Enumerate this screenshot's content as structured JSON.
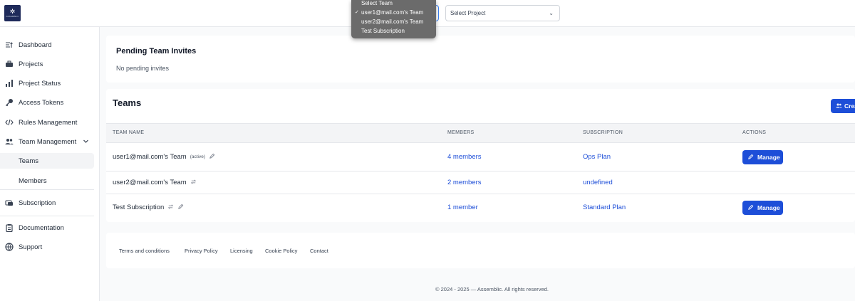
{
  "topbar": {
    "logo_mark": "✲",
    "logo_wordmark": "ASSEMBLIC",
    "project_select": {
      "value": "Select Project"
    }
  },
  "team_dropdown": {
    "items": [
      {
        "label": "Select Team",
        "checked": false
      },
      {
        "label": "user1@mail.com's Team",
        "checked": true
      },
      {
        "label": "user2@mail.com's Team",
        "checked": false
      },
      {
        "label": "Test Subscription",
        "checked": false
      }
    ],
    "check_glyph": "✓"
  },
  "sidebar": {
    "items": [
      {
        "label": "Dashboard",
        "icon": "dashboard-icon"
      },
      {
        "label": "Projects",
        "icon": "briefcase-icon"
      },
      {
        "label": "Project Status",
        "icon": "bar-chart-icon"
      },
      {
        "label": "Access Tokens",
        "icon": "key-icon"
      },
      {
        "label": "Rules Management",
        "icon": "code-icon"
      },
      {
        "label": "Team Management",
        "icon": "users-icon"
      }
    ],
    "sub_items": [
      {
        "label": "Teams",
        "active": true
      },
      {
        "label": "Members",
        "active": false
      }
    ],
    "bottom_items": [
      {
        "label": "Subscription",
        "icon": "subscription-icon"
      },
      {
        "label": "Documentation",
        "icon": "clipboard-icon"
      },
      {
        "label": "Support",
        "icon": "globe-icon"
      }
    ]
  },
  "invites": {
    "title": "Pending Team Invites",
    "empty_text": "No pending invites"
  },
  "teams": {
    "title": "Teams",
    "create_label": "Create",
    "columns": [
      "TEAM NAME",
      "MEMBERS",
      "SUBSCRIPTION",
      "ACTIONS"
    ],
    "rows": [
      {
        "name": "user1@mail.com's Team",
        "tag": "(active)",
        "members": "4 members",
        "subscription": "Ops Plan",
        "action": "Manage"
      },
      {
        "name": "user2@mail.com's Team",
        "tag": "",
        "members": "2 members",
        "subscription": "undefined",
        "action": ""
      },
      {
        "name": "Test Subscription",
        "tag": "",
        "members": "1 member",
        "subscription": "Standard Plan",
        "action": "Manage"
      }
    ]
  },
  "footer": {
    "links": [
      "Terms and conditions",
      "Privacy Policy",
      "Licensing",
      "Cookie Policy",
      "Contact"
    ],
    "copyright": "© 2024 - 2025 — Assemblic. All rights reserved."
  },
  "colors": {
    "accent": "#1d4ed8",
    "dropdown_bg": "#6b6b6b",
    "logo_bg": "#1e2a5a"
  }
}
